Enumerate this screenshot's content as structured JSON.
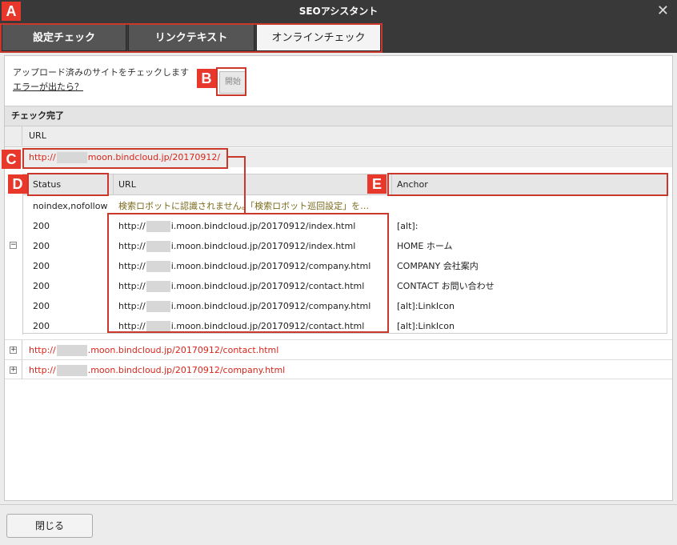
{
  "window": {
    "title": "SEOアシスタント",
    "close_glyph": "✕"
  },
  "tabs": [
    {
      "label": "設定チェック"
    },
    {
      "label": "リンクテキスト"
    },
    {
      "label": "オンラインチェック"
    }
  ],
  "intro": {
    "line1": "アップロード済みのサイトをチェックします",
    "error_link": "エラーが出たら？",
    "start_button": "開始"
  },
  "results": {
    "header": "チェック完了",
    "url_header": "URL",
    "site_prefix": "http://",
    "sites": [
      {
        "suffix": "moon.bindcloud.jp/20170912/",
        "expanded": true
      },
      {
        "suffix": ".moon.bindcloud.jp/20170912/contact.html",
        "expanded": false
      },
      {
        "suffix": ".moon.bindcloud.jp/20170912/company.html",
        "expanded": false
      }
    ],
    "detail_columns": {
      "status": "Status",
      "url": "URL",
      "anchor": "Anchor"
    },
    "detail_rows": [
      {
        "status": "noindex,nofollow",
        "url": "検索ロボットに認識されません。「検索ロボット巡回設定」を…",
        "anchor": ""
      },
      {
        "status": "200",
        "url_prefix": "http://",
        "url": "i.moon.bindcloud.jp/20170912/index.html",
        "anchor": "[alt]:"
      },
      {
        "status": "200",
        "url_prefix": "http://",
        "url": "i.moon.bindcloud.jp/20170912/index.html",
        "anchor": "HOME ホーム"
      },
      {
        "status": "200",
        "url_prefix": "http://",
        "url": "i.moon.bindcloud.jp/20170912/company.html",
        "anchor": "COMPANY 会社案内"
      },
      {
        "status": "200",
        "url_prefix": "http://",
        "url": "i.moon.bindcloud.jp/20170912/contact.html",
        "anchor": "CONTACT お問い合わせ"
      },
      {
        "status": "200",
        "url_prefix": "http://",
        "url": "i.moon.bindcloud.jp/20170912/company.html",
        "anchor": "[alt]:LinkIcon"
      },
      {
        "status": "200",
        "url_prefix": "http://",
        "url": "i.moon.bindcloud.jp/20170912/contact.html",
        "anchor": "[alt]:LinkIcon"
      }
    ]
  },
  "footer": {
    "close_button": "閉じる"
  },
  "annotations": {
    "a": "A",
    "b": "B",
    "c": "C",
    "d": "D",
    "e": "E"
  },
  "colors": {
    "accent": "#e8382b",
    "titlebar": "#393939",
    "link": "#d9261c"
  }
}
